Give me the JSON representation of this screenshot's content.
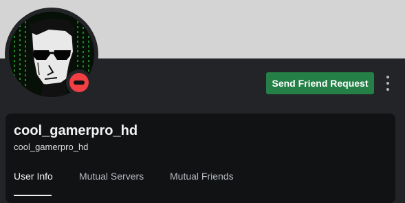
{
  "profile": {
    "display_name": "cool_gamerpro_hd",
    "username": "cool_gamerpro_hd",
    "status": "do-not-disturb",
    "status_color": "#f23f43",
    "banner_color": "#d4d4d4"
  },
  "actions": {
    "send_friend_request_label": "Send Friend Request",
    "send_friend_request_color": "#248046",
    "more_icon": "vertical-ellipsis-icon"
  },
  "tabs": [
    {
      "label": "User Info",
      "active": true
    },
    {
      "label": "Mutual Servers",
      "active": false
    },
    {
      "label": "Mutual Friends",
      "active": false
    }
  ]
}
